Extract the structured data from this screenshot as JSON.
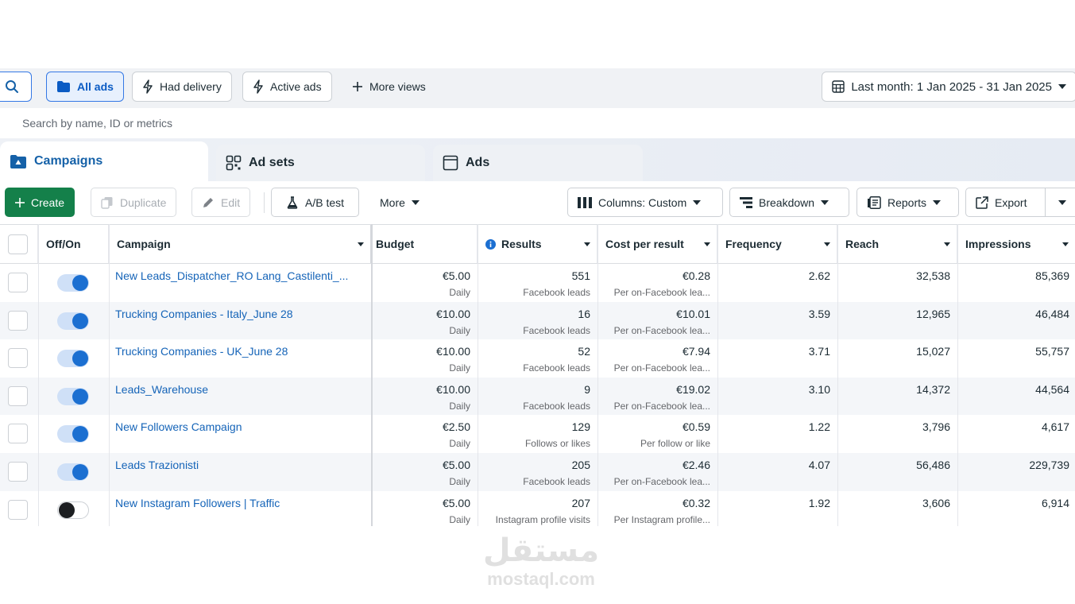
{
  "filters": {
    "all_ads": "All ads",
    "had_delivery": "Had delivery",
    "active_ads": "Active ads",
    "more_views": "More views",
    "date_range": "Last month: 1 Jan 2025 - 31 Jan 2025"
  },
  "search": {
    "placeholder": "Search by name, ID or metrics"
  },
  "tabs": [
    {
      "label": "Campaigns",
      "active": true
    },
    {
      "label": "Ad sets",
      "active": false
    },
    {
      "label": "Ads",
      "active": false
    }
  ],
  "toolbar": {
    "create": "Create",
    "duplicate": "Duplicate",
    "edit": "Edit",
    "ab_test": "A/B test",
    "more": "More",
    "columns": "Columns: Custom",
    "breakdown": "Breakdown",
    "reports": "Reports",
    "export": "Export"
  },
  "table": {
    "headers": {
      "onoff": "Off/On",
      "campaign": "Campaign",
      "budget": "Budget",
      "results": "Results",
      "cost": "Cost per result",
      "frequency": "Frequency",
      "reach": "Reach",
      "impressions": "Impressions"
    },
    "rows": [
      {
        "on": true,
        "campaign": "New Leads_Dispatcher_RO Lang_Castilenti_...",
        "budget": "€5.00",
        "budget_type": "Daily",
        "results": "551",
        "results_type": "Facebook leads",
        "cost": "€0.28",
        "cost_type": "Per on-Facebook lea...",
        "frequency": "2.62",
        "reach": "32,538",
        "impressions": "85,369"
      },
      {
        "on": true,
        "campaign": "Trucking Companies - Italy_June 28",
        "budget": "€10.00",
        "budget_type": "Daily",
        "results": "16",
        "results_type": "Facebook leads",
        "cost": "€10.01",
        "cost_type": "Per on-Facebook lea...",
        "frequency": "3.59",
        "reach": "12,965",
        "impressions": "46,484"
      },
      {
        "on": true,
        "campaign": "Trucking Companies - UK_June 28",
        "budget": "€10.00",
        "budget_type": "Daily",
        "results": "52",
        "results_type": "Facebook leads",
        "cost": "€7.94",
        "cost_type": "Per on-Facebook lea...",
        "frequency": "3.71",
        "reach": "15,027",
        "impressions": "55,757"
      },
      {
        "on": true,
        "campaign": "Leads_Warehouse",
        "budget": "€10.00",
        "budget_type": "Daily",
        "results": "9",
        "results_type": "Facebook leads",
        "cost": "€19.02",
        "cost_type": "Per on-Facebook lea...",
        "frequency": "3.10",
        "reach": "14,372",
        "impressions": "44,564"
      },
      {
        "on": true,
        "campaign": "New Followers Campaign",
        "budget": "€2.50",
        "budget_type": "Daily",
        "results": "129",
        "results_type": "Follows or likes",
        "cost": "€0.59",
        "cost_type": "Per follow or like",
        "frequency": "1.22",
        "reach": "3,796",
        "impressions": "4,617"
      },
      {
        "on": true,
        "campaign": "Leads Trazionisti",
        "budget": "€5.00",
        "budget_type": "Daily",
        "results": "205",
        "results_type": "Facebook leads",
        "cost": "€2.46",
        "cost_type": "Per on-Facebook lea...",
        "frequency": "4.07",
        "reach": "56,486",
        "impressions": "229,739"
      },
      {
        "on": false,
        "campaign": "New Instagram Followers | Traffic",
        "budget": "€5.00",
        "budget_type": "Daily",
        "results": "207",
        "results_type": "Instagram profile visits",
        "cost": "€0.32",
        "cost_type": "Per Instagram profile...",
        "frequency": "1.92",
        "reach": "3,606",
        "impressions": "6,914"
      }
    ]
  },
  "watermark": {
    "arabic": "مستقل",
    "latin": "mostaql.com"
  },
  "colors": {
    "accent": "#1564b8",
    "create": "#14804a",
    "toggle_on": "#1b6fd1"
  }
}
